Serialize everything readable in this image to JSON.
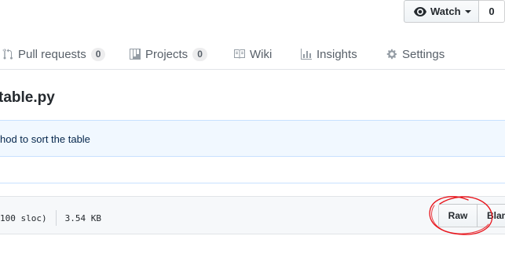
{
  "watch": {
    "label": "Watch",
    "count": "0"
  },
  "tabs": [
    {
      "label": "Pull requests",
      "count": "0",
      "icon": "git-pull-request-icon"
    },
    {
      "label": "Projects",
      "count": "0",
      "icon": "project-icon"
    },
    {
      "label": "Wiki",
      "icon": "book-icon"
    },
    {
      "label": "Insights",
      "icon": "graph-icon"
    },
    {
      "label": "Settings",
      "icon": "gear-icon"
    }
  ],
  "file": {
    "title": "table.py"
  },
  "commit": {
    "message": "hod to sort the table"
  },
  "file_header": {
    "sloc": "100 sloc)",
    "size": "3.54 KB",
    "raw_label": "Raw",
    "blame_label": "Blam"
  },
  "colors": {
    "annotation": "#e8141b",
    "link": "#0366d6",
    "commit_bg": "#f1f8ff"
  }
}
